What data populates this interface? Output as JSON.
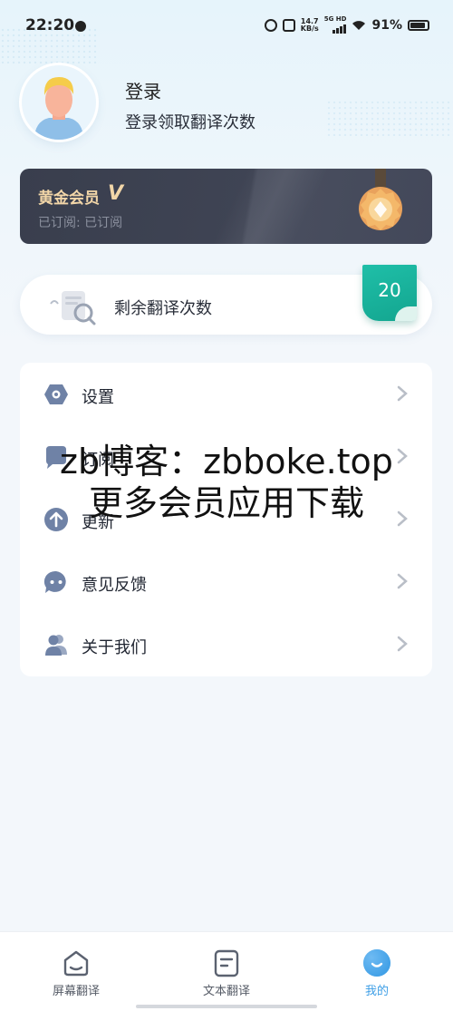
{
  "status_bar": {
    "time": "22:20",
    "net_speed_value": "14.7",
    "net_speed_unit": "KB/s",
    "network": "5G HD",
    "battery": "91%"
  },
  "profile": {
    "login_label": "登录",
    "login_subtitle": "登录领取翻译次数"
  },
  "vip": {
    "title": "黄金会员",
    "badge": "V",
    "status": "已订阅: 已订阅",
    "accent_color": "#f2d6a8"
  },
  "remaining": {
    "label": "剩余翻译次数",
    "count": "20",
    "flag_color": "#13a58f"
  },
  "menu": {
    "items": [
      {
        "label": "设置",
        "icon": "settings-icon"
      },
      {
        "label": "订阅",
        "icon": "subscribe-icon"
      },
      {
        "label": "更新",
        "icon": "update-icon"
      },
      {
        "label": "意见反馈",
        "icon": "feedback-icon"
      },
      {
        "label": "关于我们",
        "icon": "about-icon"
      }
    ]
  },
  "watermark": {
    "line1": "zb博客：zbboke.top",
    "line2": "更多会员应用下载"
  },
  "bottom_nav": {
    "tabs": [
      {
        "label": "屏幕翻译",
        "icon": "screen-translate-icon"
      },
      {
        "label": "文本翻译",
        "icon": "text-translate-icon"
      },
      {
        "label": "我的",
        "icon": "profile-icon",
        "active": true
      }
    ],
    "active_color": "#3d9ee6"
  }
}
